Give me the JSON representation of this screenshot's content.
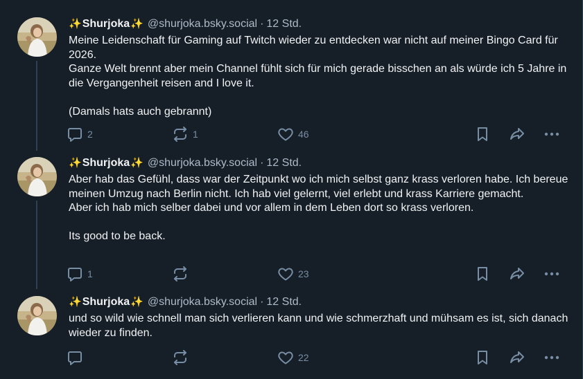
{
  "colors": {
    "background": "#161e27",
    "text": "#f1f3f5",
    "muted": "#aebbc9",
    "icon": "#788ea5",
    "divider": "#2e4052"
  },
  "posts": [
    {
      "sparkle_left": "✨",
      "display_name": "Shurjoka",
      "sparkle_right": "✨",
      "handle": "@shurjoka.bsky.social",
      "separator": "·",
      "time": "12 Std.",
      "lines": [
        "Meine Leidenschaft für Gaming auf Twitch wieder zu entdecken war nicht auf meiner Bingo Card für 2026.",
        "Ganze Welt brennt aber mein Channel fühlt sich für mich gerade bisschen an als würde ich 5 Jahre in die Vergangenheit reisen and I love it.",
        "",
        "(Damals hats auch gebrannt)"
      ],
      "replies": "2",
      "reposts": "1",
      "likes": "46",
      "icons": [
        "reply-icon",
        "repost-icon",
        "like-icon",
        "bookmark-icon",
        "share-icon",
        "more-icon"
      ]
    },
    {
      "sparkle_left": "✨",
      "display_name": "Shurjoka",
      "sparkle_right": "✨",
      "handle": "@shurjoka.bsky.social",
      "separator": "·",
      "time": "12 Std.",
      "lines": [
        "Aber hab das Gefühl, dass war der Zeitpunkt wo ich mich selbst ganz krass verloren habe. Ich bereue meinen Umzug nach Berlin nicht. Ich hab viel gelernt, viel erlebt und krass Karriere gemacht.",
        "Aber ich hab mich selber dabei und vor allem in dem Leben dort so krass verloren.",
        "",
        "Its good to be back."
      ],
      "replies": "1",
      "reposts": "",
      "likes": "23",
      "icons": [
        "reply-icon",
        "repost-icon",
        "like-icon",
        "bookmark-icon",
        "share-icon",
        "more-icon"
      ]
    },
    {
      "sparkle_left": "✨",
      "display_name": "Shurjoka",
      "sparkle_right": "✨",
      "handle": "@shurjoka.bsky.social",
      "separator": "·",
      "time": "12 Std.",
      "lines": [
        "und so wild wie schnell man sich verlieren kann und wie schmerzhaft und mühsam es ist, sich danach wieder zu finden."
      ],
      "replies": "",
      "reposts": "",
      "likes": "22",
      "icons": [
        "reply-icon",
        "repost-icon",
        "like-icon",
        "bookmark-icon",
        "share-icon",
        "more-icon"
      ]
    }
  ]
}
